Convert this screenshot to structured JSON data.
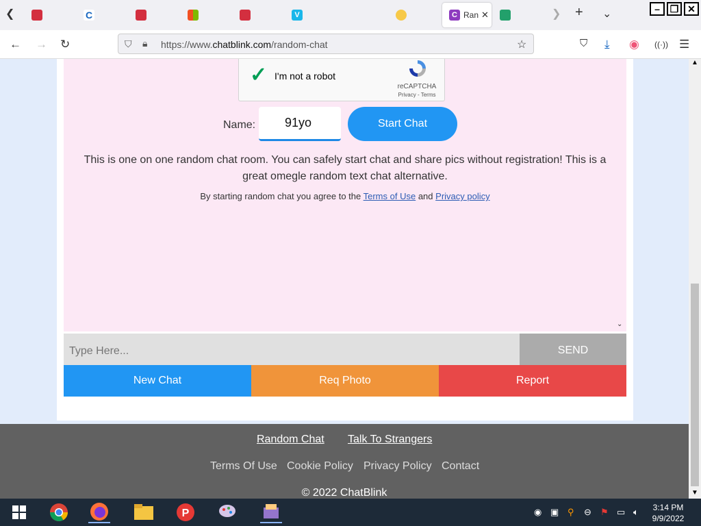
{
  "browser": {
    "active_tab_title": "Ran",
    "url_prefix": "https://www.",
    "url_domain": "chatblink.com",
    "url_path": "/random-chat"
  },
  "page": {
    "captcha": {
      "checkbox_label": "I'm not a robot",
      "brand": "reCAPTCHA",
      "links": "Privacy - Terms"
    },
    "name_label": "Name:",
    "name_value": "91yo",
    "start_button": "Start Chat",
    "description": "This is one on one random chat room. You can safely start chat and share pics without registration! This is a great omegle random text chat alternative.",
    "agree_prefix": "By starting random chat you agree to the",
    "terms_link": "Terms of Use",
    "agree_and": "and",
    "privacy_link": "Privacy policy",
    "message_placeholder": "Type Here...",
    "send_button": "SEND",
    "new_chat_button": "New Chat",
    "req_photo_button": "Req Photo",
    "report_button": "Report"
  },
  "footer": {
    "links_top": [
      "Random Chat",
      "Talk To Strangers"
    ],
    "links_bottom": [
      "Terms Of Use",
      "Cookie Policy",
      "Privacy Policy",
      "Contact"
    ],
    "copyright": "© 2022 ChatBlink"
  },
  "taskbar": {
    "time": "3:14 PM",
    "date": "9/9/2022"
  },
  "colors": {
    "start_button": "#2196f3",
    "new_chat": "#2196f3",
    "req_photo": "#f0943a",
    "report": "#e84848",
    "send": "#ababab",
    "chat_bg": "#fce8f5",
    "footer_bg": "#616161"
  }
}
